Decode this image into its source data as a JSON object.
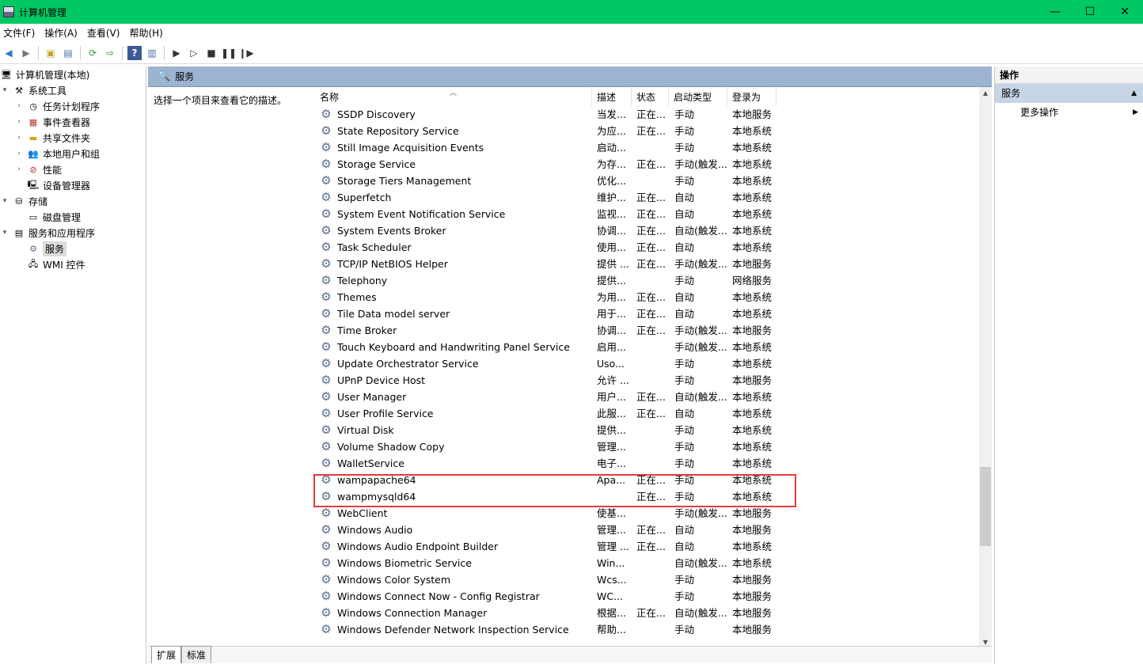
{
  "window": {
    "title": "计算机管理",
    "minimize": "—",
    "maximize": "☐",
    "close": "✕"
  },
  "menu": [
    "文件(F)",
    "操作(A)",
    "查看(V)",
    "帮助(H)"
  ],
  "tree": [
    {
      "label": "计算机管理(本地)",
      "icon": "computer-icon",
      "level": 0,
      "expander": "",
      "selected": false
    },
    {
      "label": "系统工具",
      "icon": "tools-icon",
      "level": 1,
      "expander": "▾",
      "selected": false
    },
    {
      "label": "任务计划程序",
      "icon": "clock-icon",
      "level": 2,
      "expander": "›",
      "selected": false
    },
    {
      "label": "事件查看器",
      "icon": "event-viewer-icon",
      "level": 2,
      "expander": "›",
      "selected": false
    },
    {
      "label": "共享文件夹",
      "icon": "folder-icon",
      "level": 2,
      "expander": "›",
      "selected": false
    },
    {
      "label": "本地用户和组",
      "icon": "users-icon",
      "level": 2,
      "expander": "›",
      "selected": false
    },
    {
      "label": "性能",
      "icon": "performance-icon",
      "level": 2,
      "expander": "›",
      "selected": false
    },
    {
      "label": "设备管理器",
      "icon": "device-manager-icon",
      "level": 2,
      "expander": "",
      "selected": false
    },
    {
      "label": "存储",
      "icon": "storage-icon",
      "level": 1,
      "expander": "▾",
      "selected": false
    },
    {
      "label": "磁盘管理",
      "icon": "disk-icon",
      "level": 2,
      "expander": "",
      "selected": false
    },
    {
      "label": "服务和应用程序",
      "icon": "services-apps-icon",
      "level": 1,
      "expander": "▾",
      "selected": false
    },
    {
      "label": "服务",
      "icon": "services-icon",
      "level": 2,
      "expander": "",
      "selected": true
    },
    {
      "label": "WMI 控件",
      "icon": "wmi-icon",
      "level": 2,
      "expander": "",
      "selected": false
    }
  ],
  "center": {
    "header": "服务",
    "description": "选择一个项目来查看它的描述。",
    "columns": [
      "名称",
      "描述",
      "状态",
      "启动类型",
      "登录为"
    ],
    "rows": [
      [
        "SSDP Discovery",
        "当发...",
        "正在...",
        "手动",
        "本地服务"
      ],
      [
        "State Repository Service",
        "为应...",
        "正在...",
        "手动",
        "本地系统"
      ],
      [
        "Still Image Acquisition Events",
        "启动...",
        "",
        "手动",
        "本地系统"
      ],
      [
        "Storage Service",
        "为存...",
        "正在...",
        "手动(触发...",
        "本地系统"
      ],
      [
        "Storage Tiers Management",
        "优化...",
        "",
        "手动",
        "本地系统"
      ],
      [
        "Superfetch",
        "维护...",
        "正在...",
        "自动",
        "本地系统"
      ],
      [
        "System Event Notification Service",
        "监视...",
        "正在...",
        "自动",
        "本地系统"
      ],
      [
        "System Events Broker",
        "协调...",
        "正在...",
        "自动(触发...",
        "本地系统"
      ],
      [
        "Task Scheduler",
        "使用...",
        "正在...",
        "自动",
        "本地系统"
      ],
      [
        "TCP/IP NetBIOS Helper",
        "提供 ...",
        "正在...",
        "手动(触发...",
        "本地服务"
      ],
      [
        "Telephony",
        "提供...",
        "",
        "手动",
        "网络服务"
      ],
      [
        "Themes",
        "为用...",
        "正在...",
        "自动",
        "本地系统"
      ],
      [
        "Tile Data model server",
        "用于...",
        "正在...",
        "自动",
        "本地系统"
      ],
      [
        "Time Broker",
        "协调...",
        "正在...",
        "手动(触发...",
        "本地服务"
      ],
      [
        "Touch Keyboard and Handwriting Panel Service",
        "启用...",
        "",
        "手动(触发...",
        "本地系统"
      ],
      [
        "Update Orchestrator Service",
        "Uso...",
        "",
        "手动",
        "本地系统"
      ],
      [
        "UPnP Device Host",
        "允许 ...",
        "",
        "手动",
        "本地服务"
      ],
      [
        "User Manager",
        "用户...",
        "正在...",
        "自动(触发...",
        "本地系统"
      ],
      [
        "User Profile Service",
        "此服...",
        "正在...",
        "自动",
        "本地系统"
      ],
      [
        "Virtual Disk",
        "提供...",
        "",
        "手动",
        "本地系统"
      ],
      [
        "Volume Shadow Copy",
        "管理...",
        "",
        "手动",
        "本地系统"
      ],
      [
        "WalletService",
        "电子...",
        "",
        "手动",
        "本地系统"
      ],
      [
        "wampapache64",
        "Apa...",
        "正在...",
        "手动",
        "本地系统"
      ],
      [
        "wampmysqld64",
        "",
        "正在...",
        "手动",
        "本地系统"
      ],
      [
        "WebClient",
        "使基...",
        "",
        "手动(触发...",
        "本地服务"
      ],
      [
        "Windows Audio",
        "管理...",
        "正在...",
        "自动",
        "本地服务"
      ],
      [
        "Windows Audio Endpoint Builder",
        "管理 ...",
        "正在...",
        "自动",
        "本地系统"
      ],
      [
        "Windows Biometric Service",
        "Win...",
        "",
        "自动(触发...",
        "本地系统"
      ],
      [
        "Windows Color System",
        "Wcs...",
        "",
        "手动",
        "本地服务"
      ],
      [
        "Windows Connect Now - Config Registrar",
        "WC...",
        "",
        "手动",
        "本地服务"
      ],
      [
        "Windows Connection Manager",
        "根据...",
        "正在...",
        "自动(触发...",
        "本地服务"
      ],
      [
        "Windows Defender Network Inspection Service",
        "帮助...",
        "",
        "手动",
        "本地服务"
      ]
    ],
    "tabs": [
      "扩展",
      "标准"
    ]
  },
  "actions": {
    "title": "操作",
    "section": "服务",
    "item": "更多操作"
  }
}
